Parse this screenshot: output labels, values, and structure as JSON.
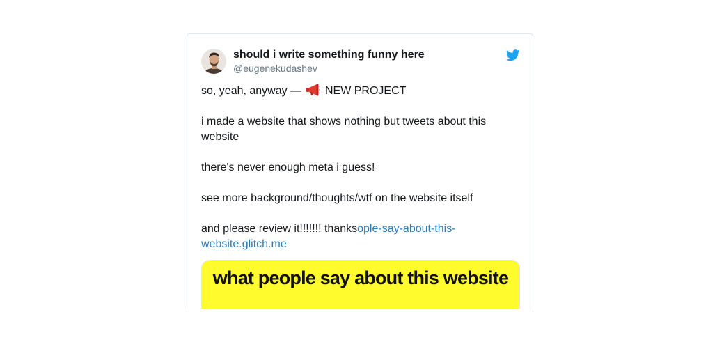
{
  "tweet": {
    "display_name": "should i write something funny here",
    "handle": "@eugenekudashev",
    "line1_prefix": "so, yeah, anyway — ",
    "line1_suffix": " NEW PROJECT",
    "paragraph2": "i made a website that shows nothing but tweets about this website",
    "paragraph3": "there's never enough meta i guess!",
    "paragraph4": "see more background/thoughts/wtf on the website itself",
    "paragraph5_text": "and please review it!!!!!!! thanks",
    "paragraph5_link": "ople-say-about-this-website.glitch.me",
    "icons": {
      "avatar": "avatar",
      "platform": "twitter-bird-icon",
      "emoji": "megaphone-icon"
    },
    "colors": {
      "link": "#2b7bb9",
      "twitter_blue": "#1da1f2",
      "card_background": "#fffb2d"
    }
  },
  "card": {
    "title": "what people say about this website"
  }
}
